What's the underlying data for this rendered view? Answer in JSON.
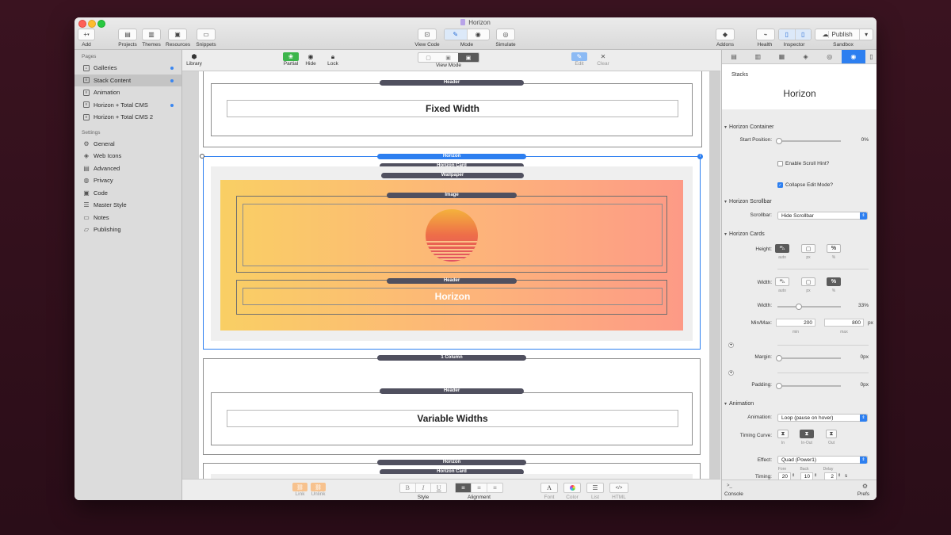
{
  "window": {
    "title": "Horizon"
  },
  "toolbar": {
    "add": "Add",
    "add_glyph": "+",
    "projects": "Projects",
    "themes": "Themes",
    "resources": "Resources",
    "snippets": "Snippets",
    "view_code": "View Code",
    "mode": "Mode",
    "simulate": "Simulate",
    "addons": "Addons",
    "health": "Health",
    "inspector": "Inspector",
    "publish": "Publish",
    "sandbox": "Sandbox"
  },
  "sidebar": {
    "pages_header": "Pages",
    "pages": [
      {
        "label": "Galleries",
        "dot": true
      },
      {
        "label": "Stack Content",
        "dot": true,
        "selected": true
      },
      {
        "label": "Animation",
        "dot": false
      },
      {
        "label": "Horizon + Total CMS",
        "dot": true
      },
      {
        "label": "Horizon + Total CMS 2",
        "dot": false
      }
    ],
    "settings_header": "Settings",
    "settings": [
      "General",
      "Web Icons",
      "Advanced",
      "Privacy",
      "Code",
      "Master Style",
      "Notes",
      "Publishing"
    ]
  },
  "center_toolbar": {
    "library": "Library",
    "partial": "Partial",
    "hide": "Hide",
    "lock": "Lock",
    "view_mode": "View Mode",
    "edit": "Edit",
    "clear": "Clear"
  },
  "canvas": {
    "blocks": {
      "header1_pill": "Header",
      "fixed_width": "Fixed Width",
      "horizon_pill": "Horizon",
      "horizon_card_pill": "Horizon Card",
      "wallpaper_pill": "Wallpaper",
      "image_pill": "Image",
      "header2_pill": "Header",
      "horizon_title": "Horizon",
      "column_pill": "1 Column",
      "header3_pill": "Header",
      "variable_widths": "Variable Widths",
      "horizon2_pill": "Horizon",
      "horizon_card2_pill": "Horizon Card"
    }
  },
  "center_bottom": {
    "link": "Link",
    "unlink": "Unlink",
    "style": "Style",
    "alignment": "Alignment",
    "font": "Font",
    "color": "Color",
    "list": "List",
    "html": "HTML",
    "bold_glyph": "B",
    "italic_glyph": "I",
    "underline_glyph": "U",
    "font_glyph": "A",
    "html_glyph": "</>"
  },
  "inspector": {
    "stacks": "Stacks",
    "stack_title": "Horizon",
    "container": {
      "header": "Horizon Container",
      "start_position_label": "Start Position:",
      "start_position_value": "0%",
      "scroll_hint_label": "Enable Scroll Hint?",
      "scroll_hint": false,
      "collapse_label": "Collapse Edit Mode?",
      "collapse": true
    },
    "scrollbar": {
      "header": "Horizon Scrollbar",
      "label": "Scrollbar:",
      "value": "Hide Scrollbar"
    },
    "cards": {
      "header": "Horizon Cards",
      "height_label": "Height:",
      "width_label": "Width:",
      "unit_auto": "auto",
      "unit_px": "px",
      "unit_pct": "%",
      "pct_glyph": "%",
      "width_value_label": "Width:",
      "width_value": "33%",
      "width_fraction": 0.33,
      "minmax_label": "Min/Max:",
      "min_value": "200",
      "max_value": "800",
      "minmax_unit": "px",
      "min_caption": "min",
      "max_caption": "max",
      "plus_glyph": "+",
      "margin_label": "Margin:",
      "margin_value": "0px",
      "padding_label": "Padding:",
      "padding_value": "0px"
    },
    "animation": {
      "header": "Animation",
      "animation_label": "Animation:",
      "animation_value": "Loop (pause on hover)",
      "timing_curve_label": "Timing Curve:",
      "curve_in": "In",
      "curve_inout": "In-Out",
      "curve_out": "Out",
      "effect_label": "Effect:",
      "effect_value": "Quad (Power1)",
      "timing_label": "Timing:",
      "fore": "20",
      "back": "10",
      "delay": "2",
      "timing_unit": "s",
      "fore_caption": "Fore",
      "back_caption": "Back",
      "delay_caption": "Delay"
    },
    "console": "Console",
    "console_glyph": ">_",
    "prefs": "Prefs"
  },
  "colors": {
    "accent": "#2d7ff0",
    "partial_green": "#3cb54a",
    "wallpaper_start": "#f9cf64",
    "wallpaper_end": "#fd9a86"
  }
}
